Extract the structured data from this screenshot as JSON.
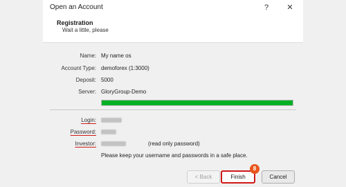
{
  "window": {
    "title": "Open an Account",
    "help_glyph": "?",
    "close_glyph": "✕"
  },
  "header": {
    "title": "Registration",
    "subtitle": "Wait a little, please"
  },
  "details": {
    "name_label": "Name:",
    "name_value": "My name os",
    "account_type_label": "Account Type:",
    "account_type_value": "demoforex (1:3000)",
    "deposit_label": "Deposit:",
    "deposit_value": "5000",
    "server_label": "Server:",
    "server_value": "GloryGroup-Demo"
  },
  "progress": {
    "percent": 100,
    "color": "#06b025"
  },
  "credentials": {
    "login_label": "Login:",
    "password_label": "Password:",
    "investor_label": "Investor:",
    "investor_note": "(read only password)",
    "note": "Please keep your username and passwords in a safe place."
  },
  "footer": {
    "back_label": "< Back",
    "finish_label": "Finish",
    "cancel_label": "Cancel",
    "step_badge": "8"
  },
  "colors": {
    "highlight": "#d01818",
    "badge": "#e8561c"
  }
}
